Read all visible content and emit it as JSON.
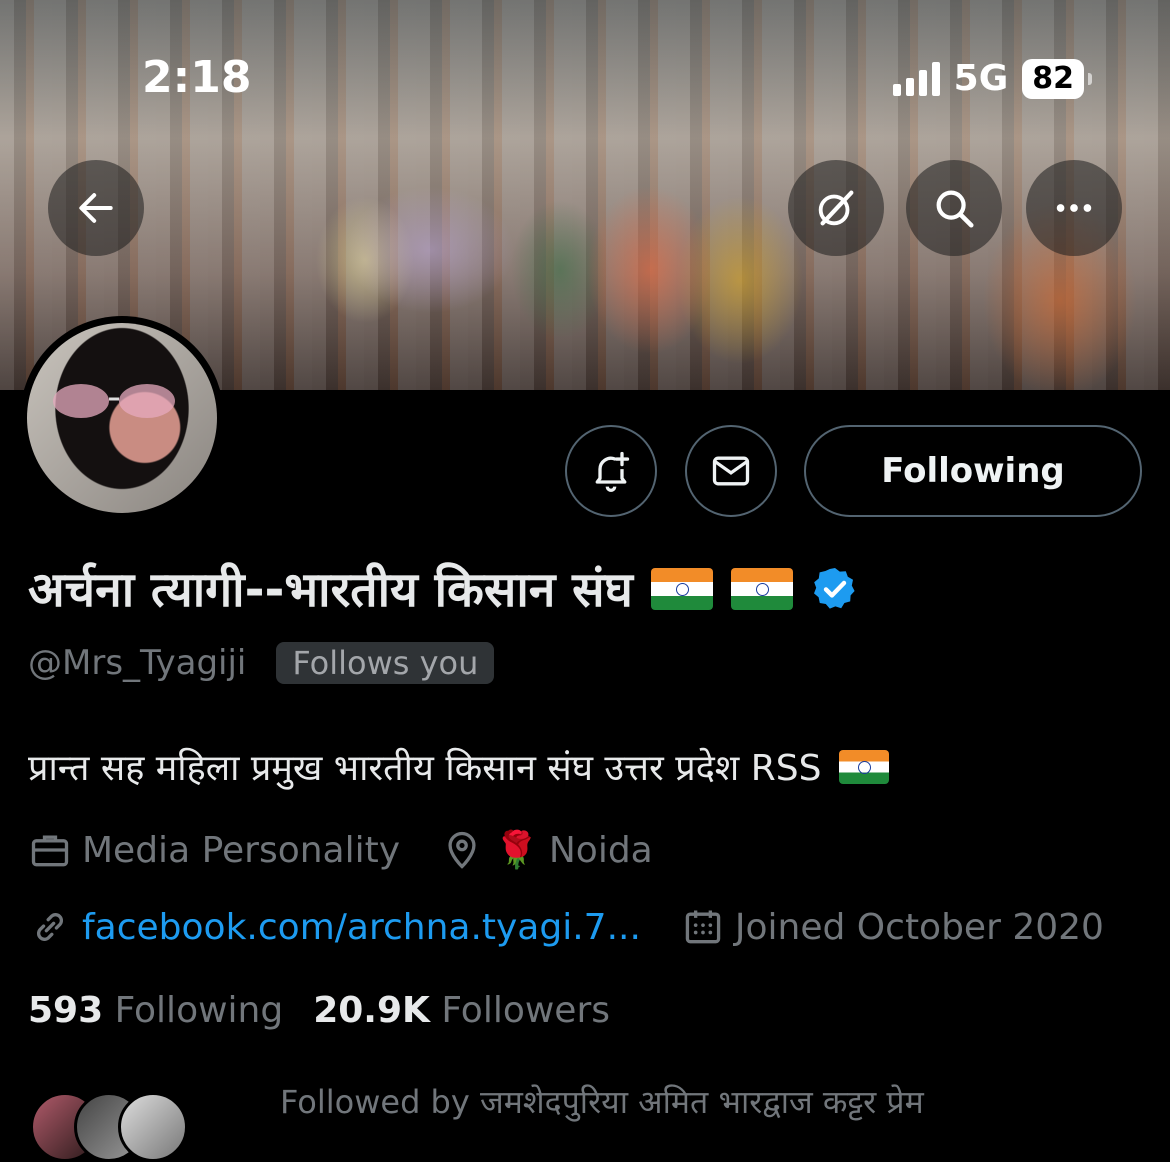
{
  "status_bar": {
    "time": "2:18",
    "network": "5G",
    "battery": "82"
  },
  "header": {
    "back_icon": "arrow-left-icon",
    "grok_icon": "grok-slash-circle-icon",
    "search_icon": "search-icon",
    "more_icon": "more-dots-icon"
  },
  "profile": {
    "display_name": "अर्चना त्यागी--भारतीय किसान संघ",
    "handle": "@Mrs_Tyagiji",
    "follows_you": "Follows you",
    "bio": "प्रान्त सह महिला प्रमुख भारतीय किसान संघ उत्तर प्रदेश RSS",
    "category": "Media Personality",
    "location_emoji": "🌹",
    "location": "Noida",
    "website": "facebook.com/archna.tyagi.7...",
    "joined": "Joined October 2020",
    "following_count": "593",
    "following_label": "Following",
    "followers_count": "20.9K",
    "followers_label": "Followers",
    "followed_by": "Followed by जमशेदपुरिया अमित भारद्वाज कट्टर प्रेम"
  },
  "actions": {
    "following_button": "Following"
  },
  "colors": {
    "accent": "#1d9bf0",
    "muted": "#71767b",
    "verified": "#1d9bf0"
  }
}
